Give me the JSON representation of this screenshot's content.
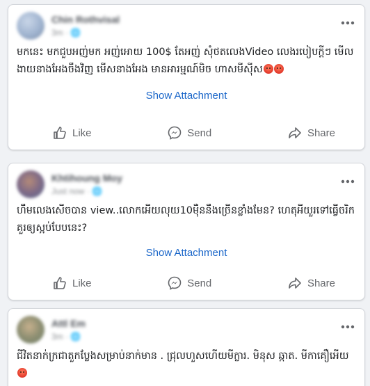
{
  "posts": [
    {
      "author": "Chin Rothvisal",
      "meta": "3m · 🌐",
      "text": "មកនេះ មកជួបអញ់មក អញ់អោយ 100$ តែអញ់ សុំថតលេងVideo លេងរបៀបក្តីៗ មើលងាយនាងអែងចឹងវិញ មើសនាងអែង មានអារម្មណ៍មិច ហាសមីស៊ីស",
      "attachment_label": "Show Attachment",
      "actions": {
        "like": "Like",
        "send": "Send",
        "share": "Share"
      }
    },
    {
      "author": "Khtihoung Moy",
      "meta": "Just now · 🌐",
      "text": "ហឹមលេងសើចបាន view..លោកអើយលុយ10ម៉ឺននឹងច្រើនខ្លាំងមែន? ហេតុអីយួរទៅធ្វើចរិកគួរឲ្យស្អប់បែបនេះ?",
      "attachment_label": "Show Attachment",
      "actions": {
        "like": "Like",
        "send": "Send",
        "share": "Share"
      }
    },
    {
      "author": "Attl Em",
      "meta": "3m · 🌐",
      "text": "ជីវិតនាក់ក្រជាតួកប្លែងសម្រាប់នាក់មាន . ជ្រុលហួសហើយមីក្លារ. មិនុស ឆ្កាត. មីកាគឿអើយ"
    }
  ],
  "icons": {
    "more": "more-horizontal-icon",
    "like": "thumbs-up-icon",
    "send": "messenger-icon",
    "share": "share-arrow-icon"
  },
  "colors": {
    "link": "#1a66c9",
    "action_text": "#65676b",
    "background": "#f0f2f5"
  }
}
